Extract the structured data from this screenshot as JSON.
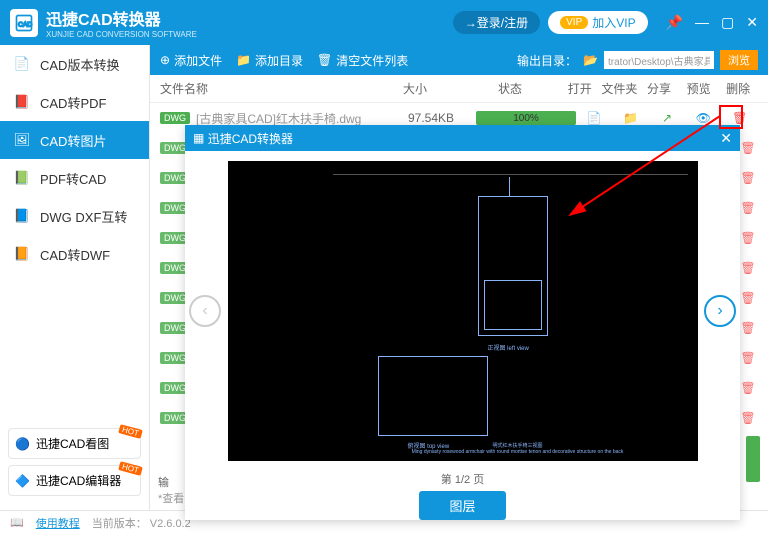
{
  "titlebar": {
    "app_name": "迅捷CAD转换器",
    "app_sub": "XUNJIE CAD CONVERSION SOFTWARE",
    "login": "登录/注册",
    "vip_badge": "VIP",
    "join_vip": "加入VIP"
  },
  "sidebar": {
    "items": [
      {
        "label": "CAD版本转换"
      },
      {
        "label": "CAD转PDF"
      },
      {
        "label": "CAD转图片"
      },
      {
        "label": "PDF转CAD"
      },
      {
        "label": "DWG DXF互转"
      },
      {
        "label": "CAD转DWF"
      }
    ],
    "promo1": "迅捷CAD看图",
    "promo2": "迅捷CAD编辑器",
    "hot": "HOT"
  },
  "toolbar": {
    "add_file": "添加文件",
    "add_dir": "添加目录",
    "clear": "清空文件列表",
    "output_label": "输出目录：",
    "output_path": "trator\\Desktop\\古典家具GIF",
    "browse": "浏览"
  },
  "table": {
    "h_name": "文件名称",
    "h_size": "大小",
    "h_status": "状态",
    "h_open": "打开",
    "h_folder": "文件夹",
    "h_share": "分享",
    "h_preview": "预览",
    "h_delete": "删除"
  },
  "file": {
    "badge": "DWG",
    "name": "[古典家具CAD]红木扶手椅.dwg",
    "size": "97.54KB",
    "progress": "100%"
  },
  "preview": {
    "title": "迅捷CAD转换器",
    "page": "第 1/2 页",
    "layer_btn": "图层"
  },
  "statusbar": {
    "tutorial": "使用教程",
    "version": "当前版本： V2.6.0.2",
    "output_label": "输",
    "option": "*查看"
  }
}
